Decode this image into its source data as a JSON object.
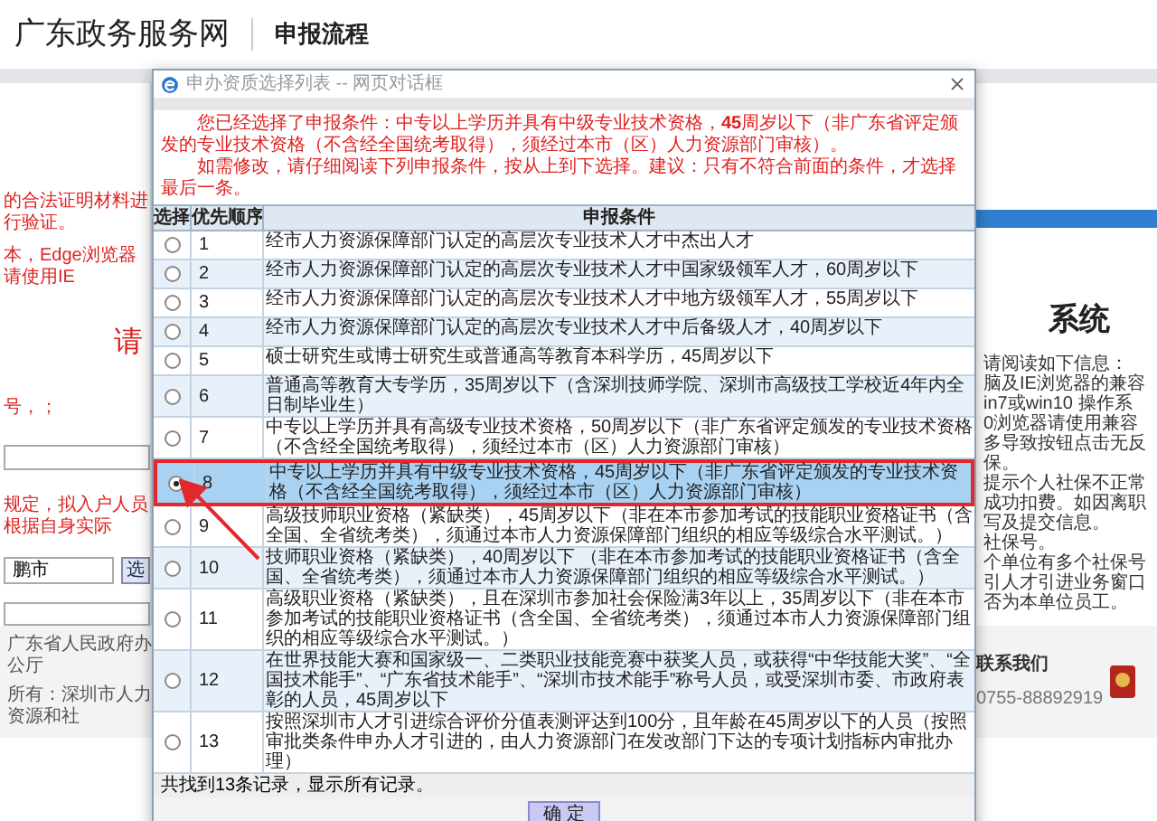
{
  "site_header": {
    "logo": "广东政务服务网",
    "page_title": "申报流程"
  },
  "left_fragments": [
    {
      "kind": "note",
      "text": "的合法证明材料进行验证。"
    },
    {
      "kind": "note",
      "text": "本，Edge浏览器请使用IE"
    },
    {
      "kind": "heading",
      "text": "请"
    },
    {
      "kind": "note",
      "text": "号，；"
    },
    {
      "kind": "field"
    },
    {
      "kind": "note",
      "text": "规定，拟入户人员根据自身实际"
    },
    {
      "kind": "picker",
      "value": "鹏市",
      "button": "选"
    },
    {
      "kind": "select"
    }
  ],
  "right_panel": {
    "heading": "系统",
    "lines": [
      "请阅读如下信息：",
      "脑及IE浏览器的兼容",
      "in7或win10 操作系",
      "0浏览器请使用兼容",
      "多导致按钮点击无反",
      "保。",
      "提示个人社保不正常",
      "成功扣费。如因离职",
      "写及提交信息。",
      "社保号。",
      "个单位有多个社保号",
      "引人才引进业务窗口",
      "否为本单位员工。"
    ]
  },
  "footer": {
    "lines": [
      "广东省人民政府办公厅",
      "所有：深圳市人力资源和社"
    ],
    "contact_title": "联系我们",
    "phone": "0755-88892919"
  },
  "dialog": {
    "title": "申办资质选择列表 -- 网页对话框",
    "notice": [
      "您已经选择了申报条件：中专以上学历并具有中级专业技术资格，**45**周岁以下（非广东省评定颁发的专业技术资格（不含经全国统考取得），须经过本市（区）人力资源部门审核）。",
      "如需修改，请仔细阅读下列申报条件，按从上到下选择。建议：只有不符合前面的条件，才选择最后一条。"
    ],
    "columns": [
      "选择",
      "优先顺序",
      "申报条件"
    ],
    "rows": [
      {
        "order": "1",
        "condition": "经市人力资源保障部门认定的高层次专业技术人才中杰出人才",
        "selected": false
      },
      {
        "order": "2",
        "condition": "经市人力资源保障部门认定的高层次专业技术人才中国家级领军人才，60周岁以下",
        "selected": false
      },
      {
        "order": "3",
        "condition": "经市人力资源保障部门认定的高层次专业技术人才中地方级领军人才，55周岁以下",
        "selected": false
      },
      {
        "order": "4",
        "condition": "经市人力资源保障部门认定的高层次专业技术人才中后备级人才，40周岁以下",
        "selected": false
      },
      {
        "order": "5",
        "condition": "硕士研究生或博士研究生或普通高等教育本科学历，45周岁以下",
        "selected": false
      },
      {
        "order": "6",
        "condition": "普通高等教育大专学历，35周岁以下（含深圳技师学院、深圳市高级技工学校近4年内全日制毕业生）",
        "selected": false
      },
      {
        "order": "7",
        "condition": "中专以上学历并具有高级专业技术资格，50周岁以下（非广东省评定颁发的专业技术资格（不含经全国统考取得），须经过本市（区）人力资源部门审核）",
        "selected": false
      },
      {
        "order": "8",
        "condition": "中专以上学历并具有中级专业技术资格，45周岁以下（非广东省评定颁发的专业技术资格（不含经全国统考取得），须经过本市（区）人力资源部门审核）",
        "selected": true
      },
      {
        "order": "9",
        "condition": "高级技师职业资格（紧缺类），45周岁以下（非在本市参加考试的技能职业资格证书（含全国、全省统考类），须通过本市人力资源保障部门组织的相应等级综合水平测试。）",
        "selected": false
      },
      {
        "order": "10",
        "condition": "技师职业资格（紧缺类），40周岁以下 （非在本市参加考试的技能职业资格证书（含全国、全省统考类），须通过本市人力资源保障部门组织的相应等级综合水平测试。）",
        "selected": false
      },
      {
        "order": "11",
        "condition": "高级职业资格（紧缺类），且在深圳市参加社会保险满3年以上，35周岁以下（非在本市参加考试的技能职业资格证书（含全国、全省统考类），须通过本市人力资源保障部门组织的相应等级综合水平测试。）",
        "selected": false
      },
      {
        "order": "12",
        "condition": "在世界技能大赛和国家级一、二类职业技能竞赛中获奖人员，或获得“中华技能大奖”、“全国技术能手”、“广东省技术能手”、“深圳市技术能手”称号人员，或受深圳市委、市政府表彰的人员，45周岁以下",
        "selected": false
      },
      {
        "order": "13",
        "condition": "按照深圳市人才引进综合评价分值表测评达到100分，且年龄在45周岁以下的人员（按照审批类条件申办人才引进的，由人力资源部门在发改部门下达的专项计划指标内审批办理）",
        "selected": false
      }
    ],
    "summary": "共找到13条记录，显示所有记录。",
    "confirm_button": "确 定"
  }
}
